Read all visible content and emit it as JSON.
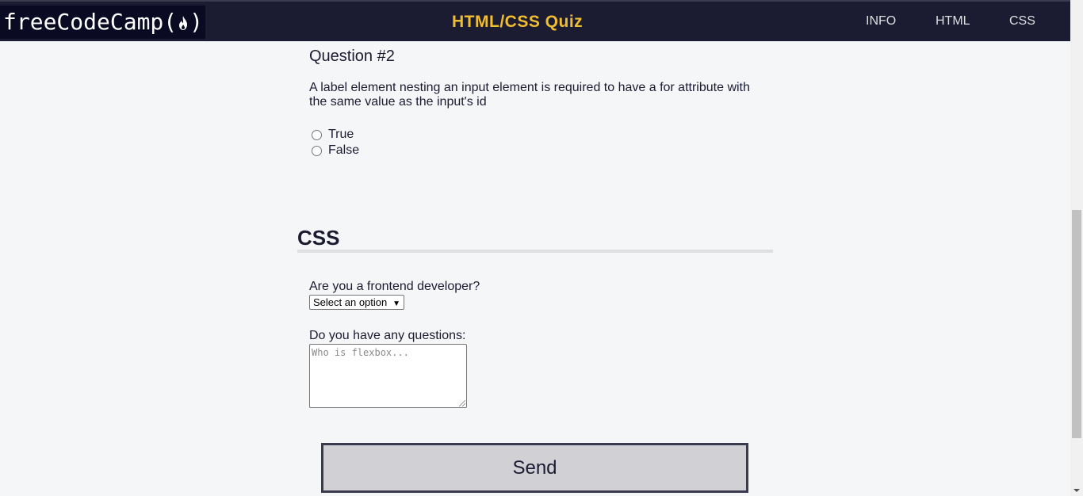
{
  "header": {
    "logo_text": "freeCodeCamp(",
    "logo_close": ")",
    "title": "HTML/CSS Quiz",
    "nav": [
      "INFO",
      "HTML",
      "CSS"
    ]
  },
  "question": {
    "title": "Question #2",
    "text": "A label element nesting an input element is required to have a for attribute with the same value as the input's id",
    "options": [
      "True",
      "False"
    ]
  },
  "css_section": {
    "heading": "CSS",
    "select_label": "Are you a frontend developer?",
    "select_value": "Select an option",
    "textarea_label": "Do you have any questions:",
    "textarea_placeholder": "Who is flexbox..."
  },
  "submit": {
    "label": "Send"
  },
  "colors": {
    "header_bg": "#1b1b32",
    "title_accent": "#f1be32",
    "page_bg": "#f5f6f7"
  }
}
